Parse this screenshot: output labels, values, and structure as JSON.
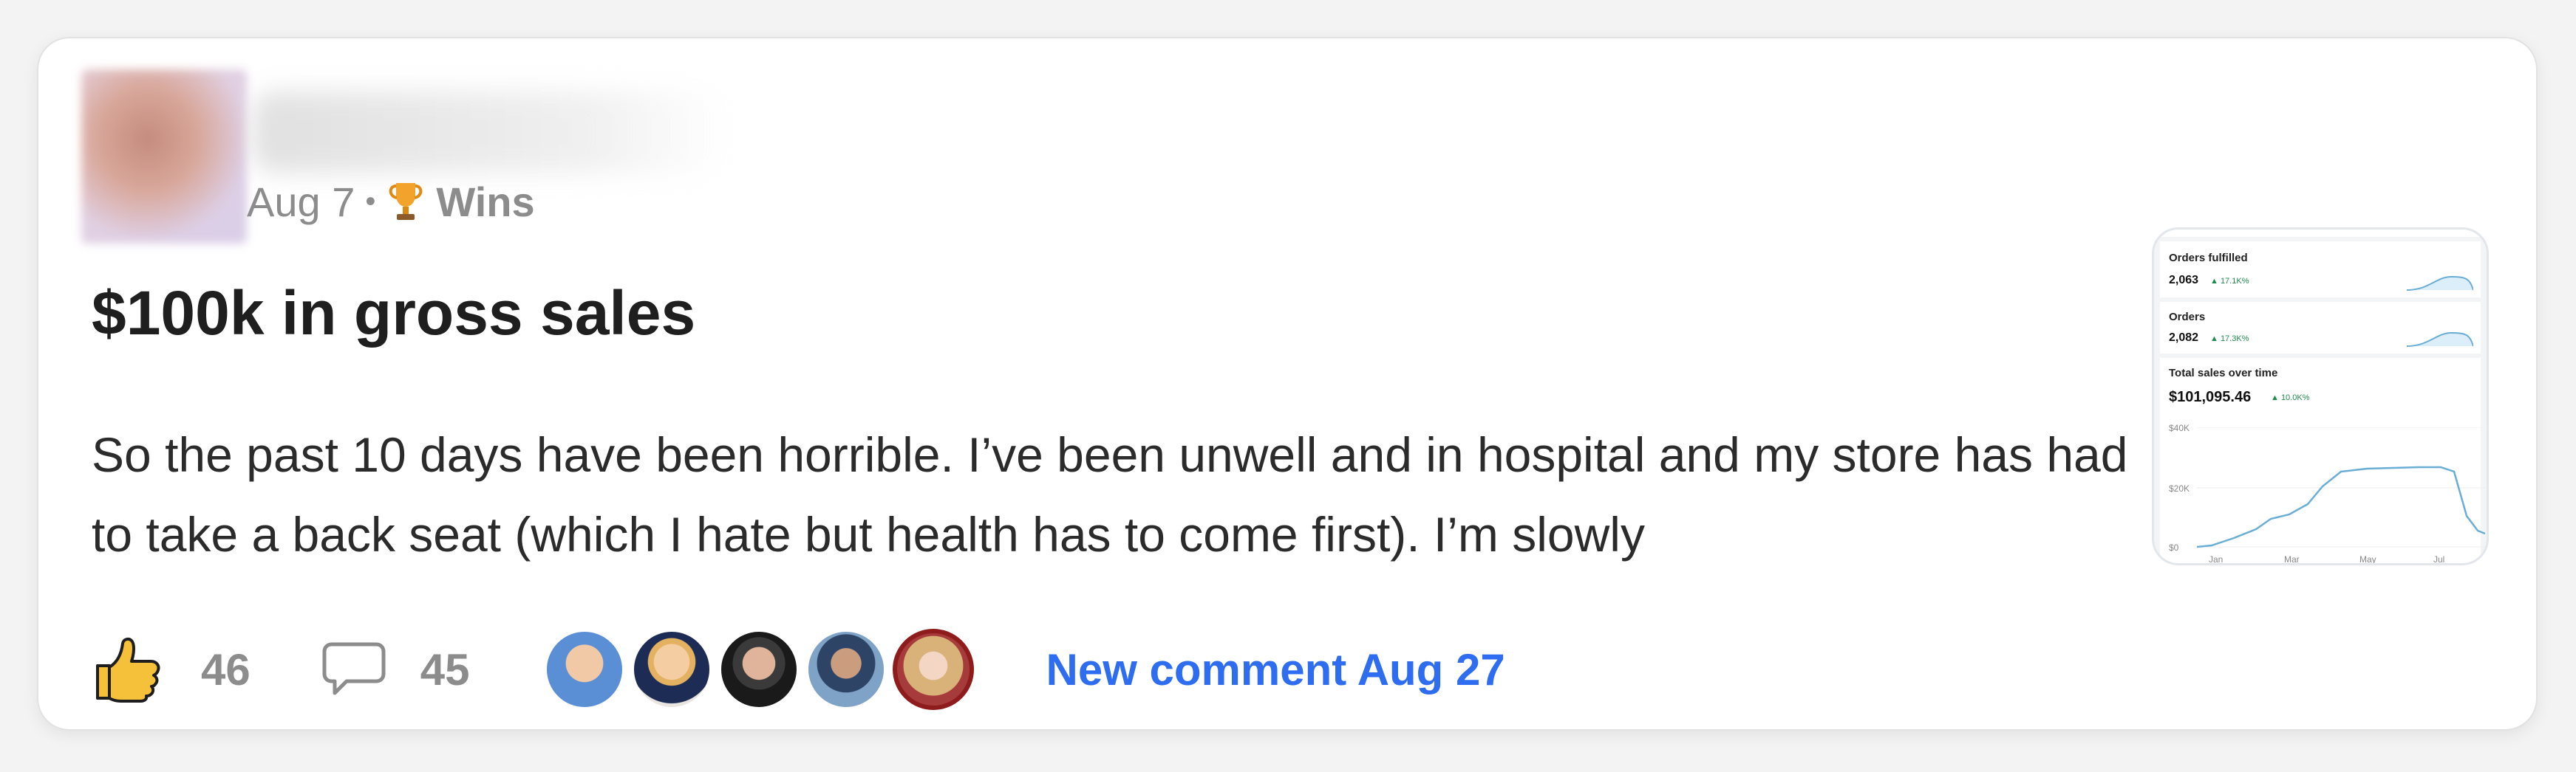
{
  "post": {
    "date": "Aug 7",
    "separator": "•",
    "category_icon": "trophy-icon",
    "category": "Wins",
    "title": "$100k in gross sales",
    "body": "So the past 10 days have been horrible. I’ve been unwell and in hospital and my store has had to take a back seat (which I hate but health has to come first). I’m slowly"
  },
  "thumbnail": {
    "orders_fulfilled_label": "Orders fulfilled",
    "orders_fulfilled_value": "2,063",
    "orders_fulfilled_change": "▲ 17.1K%",
    "orders_label": "Orders",
    "orders_value": "2,082",
    "orders_change": "▲ 17.3K%",
    "sales_label": "Total sales over time",
    "sales_value": "$101,095.46",
    "sales_change": "▲ 10.0K%",
    "y_ticks": [
      "$40K",
      "$20K",
      "$0"
    ],
    "x_ticks": [
      "Jan",
      "Mar",
      "May",
      "Jul"
    ]
  },
  "actions": {
    "like_icon": "thumbs-up-icon",
    "like_count": "46",
    "comment_icon": "speech-bubble-icon",
    "comment_count": "45",
    "new_comment": "New comment Aug 27"
  },
  "colors": {
    "accent": "#2e6df0",
    "muted": "#8c8c8c",
    "chart_line": "#6aaed6",
    "positive": "#1f8b4c"
  }
}
